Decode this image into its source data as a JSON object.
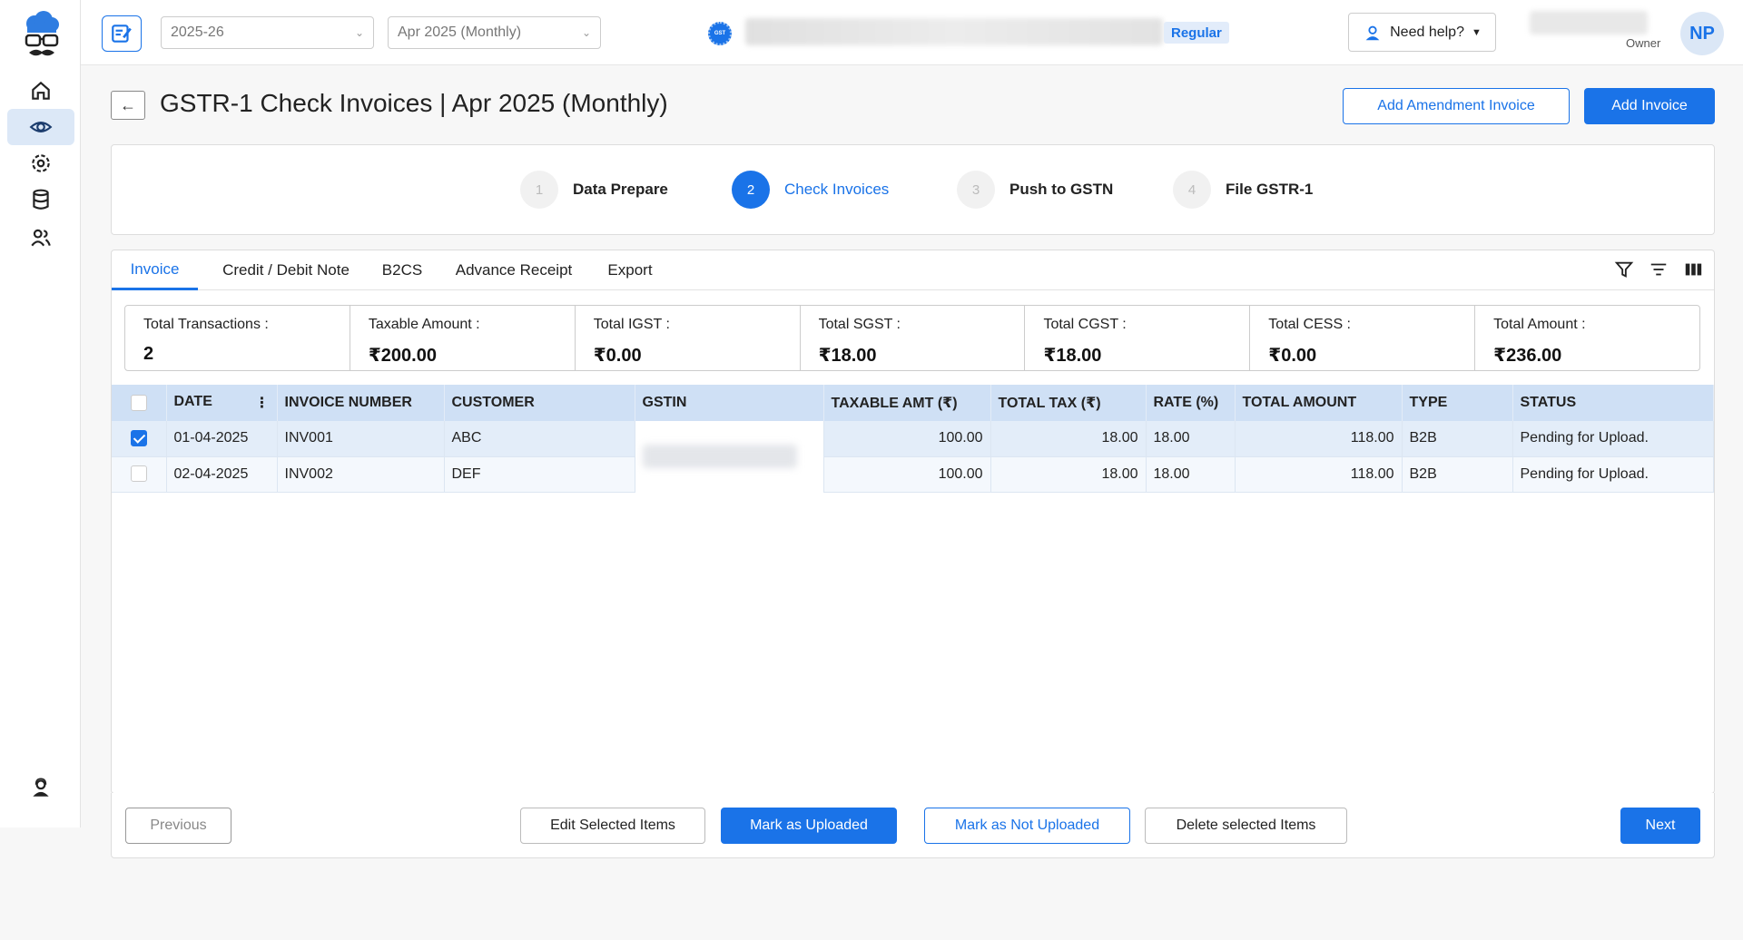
{
  "topbar": {
    "financial_year": "2025-26",
    "period": "Apr 2025 (Monthly)",
    "taxpayer_type": "Regular",
    "help_label": "Need help?",
    "user_role": "Owner",
    "user_initials": "NP",
    "gst_badge_text": "GST"
  },
  "header": {
    "title": "GSTR-1 Check Invoices | Apr 2025 (Monthly)",
    "add_amendment_label": "Add Amendment Invoice",
    "add_invoice_label": "Add Invoice"
  },
  "steps": [
    {
      "number": "1",
      "label": "Data Prepare"
    },
    {
      "number": "2",
      "label": "Check Invoices"
    },
    {
      "number": "3",
      "label": "Push to GSTN"
    },
    {
      "number": "4",
      "label": "File GSTR-1"
    }
  ],
  "tabs": [
    "Invoice",
    "Credit / Debit Note",
    "B2CS",
    "Advance Receipt",
    "Export"
  ],
  "summary": [
    {
      "label": "Total Transactions :",
      "value": "2"
    },
    {
      "label": "Taxable Amount :",
      "value": "₹200.00"
    },
    {
      "label": "Total IGST :",
      "value": "₹0.00"
    },
    {
      "label": "Total SGST :",
      "value": "₹18.00"
    },
    {
      "label": "Total CGST :",
      "value": "₹18.00"
    },
    {
      "label": "Total CESS :",
      "value": "₹0.00"
    },
    {
      "label": "Total Amount :",
      "value": "₹236.00"
    }
  ],
  "table": {
    "columns": [
      "DATE",
      "INVOICE NUMBER",
      "CUSTOMER",
      "GSTIN",
      "TAXABLE AMT (₹)",
      "TOTAL TAX (₹)",
      "RATE (%)",
      "TOTAL AMOUNT",
      "TYPE",
      "STATUS"
    ],
    "rows": [
      {
        "checked": true,
        "date": "01-04-2025",
        "invoice": "INV001",
        "customer": "ABC",
        "taxable": "100.00",
        "tax": "18.00",
        "rate": "18.00",
        "total": "118.00",
        "type": "B2B",
        "status": "Pending for Upload."
      },
      {
        "checked": false,
        "date": "02-04-2025",
        "invoice": "INV002",
        "customer": "DEF",
        "taxable": "100.00",
        "tax": "18.00",
        "rate": "18.00",
        "total": "118.00",
        "type": "B2B",
        "status": "Pending for Upload."
      }
    ]
  },
  "footer": {
    "previous_label": "Previous",
    "edit_label": "Edit Selected Items",
    "mark_uploaded_label": "Mark as Uploaded",
    "mark_not_uploaded_label": "Mark as Not Uploaded",
    "delete_label": "Delete selected Items",
    "next_label": "Next"
  },
  "colors": {
    "accent": "#1a73e8",
    "table_header": "#cfe0f5",
    "selected_row": "#e3edf9"
  }
}
